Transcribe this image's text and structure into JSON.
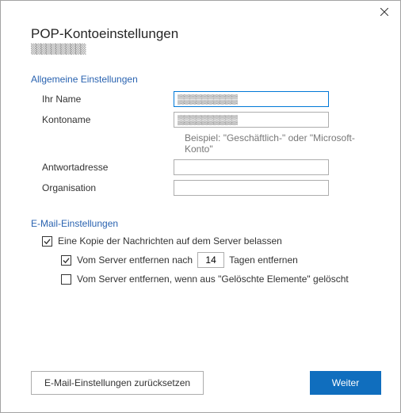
{
  "dialog": {
    "title": "POP-Kontoeinstellungen",
    "subtitle_obscured": "▒▒▒▒▒▒▒▒▒▒▒"
  },
  "sections": {
    "general": {
      "header": "Allgemeine Einstellungen",
      "name_label": "Ihr Name",
      "name_value_obscured": "▒▒▒▒▒▒▒▒▒▒",
      "account_label": "Kontoname",
      "account_value_obscured": "▒▒▒▒▒▒▒▒▒▒",
      "account_example": "Beispiel: \"Geschäftlich-\" oder \"Microsoft-Konto\"",
      "reply_label": "Antwortadresse",
      "reply_value": "",
      "org_label": "Organisation",
      "org_value": ""
    },
    "email": {
      "header": "E-Mail-Einstellungen",
      "leave_copy_label": "Eine Kopie der Nachrichten auf dem Server belassen",
      "leave_copy_checked": true,
      "remove_after_label_pre": "Vom Server entfernen nach",
      "remove_after_days": "14",
      "remove_after_label_post": "Tagen entfernen",
      "remove_after_checked": true,
      "remove_deleted_label": "Vom Server entfernen, wenn aus \"Gelöschte Elemente\" gelöscht",
      "remove_deleted_checked": false
    }
  },
  "buttons": {
    "reset": "E-Mail-Einstellungen zurücksetzen",
    "next": "Weiter"
  }
}
